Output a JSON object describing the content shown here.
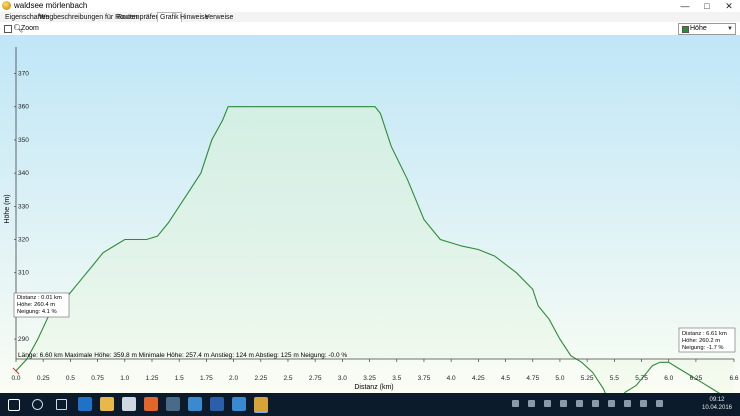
{
  "window": {
    "title": "waldsee mörlenbach",
    "minimize": "—",
    "maximize": "□",
    "close": "✕"
  },
  "tabs": [
    {
      "label": "Eigenschaften",
      "active": false
    },
    {
      "label": "Wegbeschreibungen für Routen",
      "active": false
    },
    {
      "label": "Routenpräferenz",
      "active": false
    },
    {
      "label": "Grafik",
      "active": true
    },
    {
      "label": "Hinweise",
      "active": false
    },
    {
      "label": "Verweise",
      "active": false
    }
  ],
  "toolbar": {
    "zoom_label": "Zoom",
    "zoom_checked": false,
    "zoom_icon": "magnifier-icon",
    "series_select": {
      "value": "Höhe",
      "swatch_color": "#2e8b3a"
    }
  },
  "chart_data": {
    "type": "area",
    "xlabel": "Distanz  (km)",
    "ylabel": "Höhe (m)",
    "xlim": [
      0,
      6.6
    ],
    "ylim": [
      284,
      378
    ],
    "x_ticks": [
      0.0,
      0.25,
      0.5,
      0.75,
      1.0,
      1.25,
      1.5,
      1.75,
      2.0,
      2.25,
      2.5,
      2.75,
      3.0,
      3.25,
      3.5,
      3.75,
      4.0,
      4.25,
      4.5,
      4.75,
      5.0,
      5.25,
      5.5,
      5.75,
      6.0,
      6.25,
      6.6
    ],
    "x_tick_labels": [
      "0.0",
      "0.25",
      "0.5",
      "0.75",
      "1.0",
      "1.25",
      "1.5",
      "1.75",
      "2.0",
      "2.25",
      "2.5",
      "2.75",
      "3.0",
      "3.25",
      "3.5",
      "3.75",
      "4.0",
      "4.25",
      "4.5",
      "4.75",
      "5.0",
      "5.25",
      "5.5",
      "5.75",
      "6.0",
      "6.25",
      "6.6"
    ],
    "y_ticks": [
      290,
      300,
      310,
      320,
      330,
      340,
      350,
      360,
      370
    ],
    "grid": false,
    "series": [
      {
        "color": "#2e8b3a",
        "x": [
          0.0,
          0.1,
          0.2,
          0.3,
          0.4,
          0.5,
          0.6,
          0.7,
          0.8,
          0.9,
          1.0,
          1.1,
          1.2,
          1.3,
          1.4,
          1.5,
          1.6,
          1.7,
          1.8,
          1.9,
          1.95,
          2.0,
          2.2,
          2.6,
          3.0,
          3.3,
          3.35,
          3.45,
          3.6,
          3.75,
          3.9,
          4.1,
          4.25,
          4.4,
          4.6,
          4.75,
          4.8,
          4.9,
          5.0,
          5.1,
          5.2,
          5.3,
          5.4,
          5.45,
          5.5,
          5.6,
          5.7,
          5.8,
          5.85,
          5.92,
          6.0,
          6.1,
          6.2,
          6.3,
          6.4,
          6.5,
          6.6
        ],
        "y": [
          280.4,
          284,
          290,
          297,
          300,
          304,
          308,
          312,
          316,
          318,
          320,
          320,
          320,
          321,
          325,
          330,
          335,
          340,
          350,
          356,
          360,
          360,
          360,
          360,
          360,
          360,
          358,
          348,
          338,
          326,
          320,
          318,
          317,
          315,
          310,
          305,
          300,
          296,
          290,
          285,
          283,
          280,
          275,
          271,
          270,
          274,
          276,
          280,
          282,
          283,
          283,
          281,
          279,
          277,
          275,
          273,
          270
        ]
      }
    ],
    "cursor_left": {
      "text": [
        "Distanz  : 0.01 km",
        "Höhe: 260.4 m",
        "Neigung: 4.1 %"
      ]
    },
    "cursor_right": {
      "text": [
        "Distanz  : 6.61 km",
        "Höhe: 260.2 m",
        "Neigung: -1.7 %"
      ]
    },
    "summary": "Länge: 6.60 km   Maximale Höhe: 359.8 m   Minimale Höhe: 257.4 m   Anstieg: 124 m   Abstieg: 125 m   Neigung: -0.0 %"
  },
  "taskbar": {
    "icons": [
      "windows-start-icon",
      "search-icon",
      "task-view-icon",
      "edge-icon",
      "file-explorer-icon",
      "store-icon",
      "firefox-icon",
      "app-icon",
      "chrome-icon",
      "word-icon",
      "app-icon-2",
      "mapsource-icon"
    ],
    "time": "09:12",
    "date": "10.04.2016"
  }
}
